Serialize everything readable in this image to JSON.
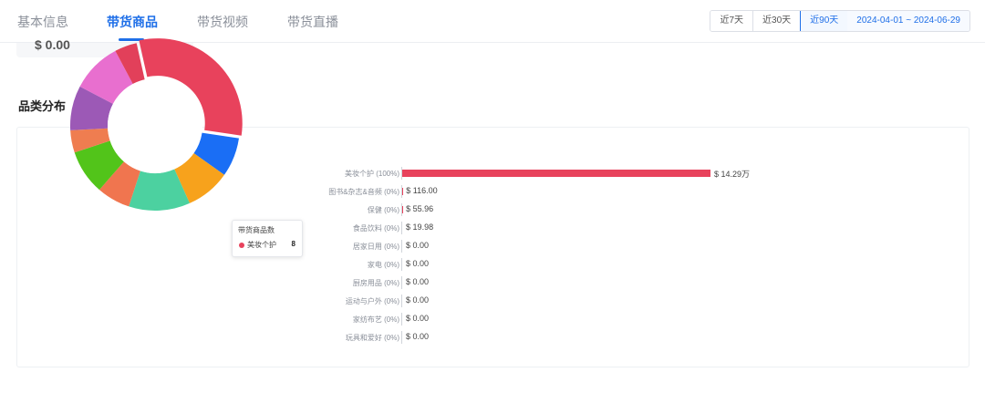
{
  "tabs": [
    {
      "label": "基本信息",
      "active": false
    },
    {
      "label": "带货商品",
      "active": true
    },
    {
      "label": "带货视频",
      "active": false
    },
    {
      "label": "带货直播",
      "active": false
    }
  ],
  "date_range": {
    "options": [
      {
        "label": "近7天",
        "active": false
      },
      {
        "label": "近30天",
        "active": false
      },
      {
        "label": "近90天",
        "active": true
      }
    ],
    "dates": "2024-04-01 ~ 2024-06-29"
  },
  "previous_card_value": "$ 0.00",
  "section_title": "品类分布",
  "tooltip": {
    "title": "带货商品数",
    "label": "美妆个护",
    "value": "8"
  },
  "chart_data": {
    "type": "bar",
    "categories": [
      "美妆个护 (100%)",
      "图书&杂志&音频 (0%)",
      "保健 (0%)",
      "食品饮料 (0%)",
      "居家日用 (0%)",
      "家电 (0%)",
      "厨房用品 (0%)",
      "运动与户外 (0%)",
      "家纺布艺 (0%)",
      "玩具和爱好 (0%)"
    ],
    "values": [
      142900,
      116.0,
      55.96,
      19.98,
      0,
      0,
      0,
      0,
      0,
      0
    ],
    "value_labels": [
      "$ 14.29万",
      "$ 116.00",
      "$ 55.96",
      "$ 19.98",
      "$ 0.00",
      "$ 0.00",
      "$ 0.00",
      "$ 0.00",
      "$ 0.00",
      "$ 0.00"
    ],
    "bar_color": "#e8425c"
  },
  "donut_data": {
    "type": "pie",
    "slices": [
      {
        "value": 29,
        "color": "#e8425c"
      },
      {
        "value": 7,
        "color": "#1a6ef5"
      },
      {
        "value": 8,
        "color": "#f7a21c"
      },
      {
        "value": 11,
        "color": "#4cd1a0"
      },
      {
        "value": 6,
        "color": "#f0754f"
      },
      {
        "value": 8,
        "color": "#52c41a"
      },
      {
        "value": 4,
        "color": "#ef7d50"
      },
      {
        "value": 8,
        "color": "#9c59b6"
      },
      {
        "value": 9,
        "color": "#e86fcf"
      },
      {
        "value": 4,
        "color": "#e2405a"
      }
    ]
  }
}
